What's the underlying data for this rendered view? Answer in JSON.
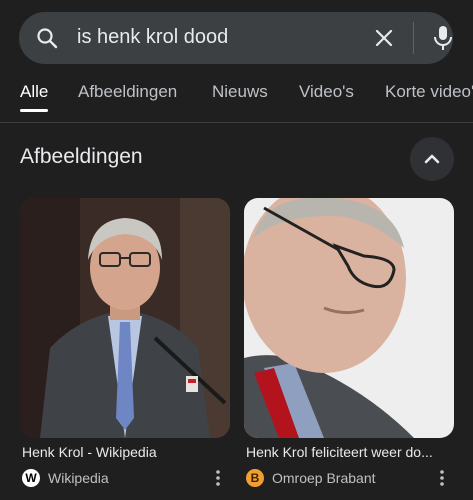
{
  "search": {
    "query": "is henk krol dood"
  },
  "tabs": [
    {
      "label": "Alle",
      "active": true
    },
    {
      "label": "Afbeeldingen"
    },
    {
      "label": "Nieuws"
    },
    {
      "label": "Video's"
    },
    {
      "label": "Korte video's"
    }
  ],
  "section": {
    "title": "Afbeeldingen"
  },
  "images": [
    {
      "caption": "Henk Krol - Wikipedia",
      "source": "Wikipedia",
      "favicon": "W"
    },
    {
      "caption": "Henk Krol feliciteert weer do...",
      "source": "Omroep Brabant",
      "favicon": "B"
    }
  ],
  "icons": {
    "search": "search-icon",
    "clear": "close-icon",
    "mic": "mic-icon",
    "collapse": "chevron-up-icon",
    "more": "more-vert-icon"
  }
}
